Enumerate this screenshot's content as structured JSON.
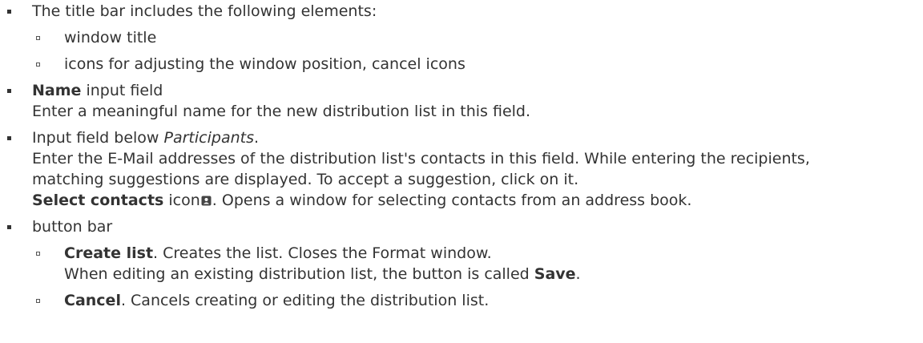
{
  "items": {
    "title_bar": {
      "text": "The title bar includes the following elements:",
      "sub": [
        "window title",
        "icons for adjusting the window position, cancel icons"
      ]
    },
    "name_field": {
      "bold": "Name",
      "rest": " input field",
      "line2": "Enter a meaningful name for the new distribution list in this field."
    },
    "participants": {
      "pre": "Input field below ",
      "italic": "Participants",
      "post": ".",
      "line2": "Enter the E-Mail addresses of the distribution list's contacts in this field. While entering the recipients,",
      "line3": "matching suggestions are displayed. To accept a suggestion, click on it.",
      "select_bold": "Select contacts",
      "select_mid": " icon",
      "select_rest": ". Opens a window for selecting contacts from an address book.",
      "select_icon": "address-book-icon"
    },
    "button_bar": {
      "text": "button bar",
      "create": {
        "bold": "Create list",
        "rest": ". Creates the list. Closes the Format window.",
        "line2_pre": "When editing an existing distribution list, the button is called ",
        "line2_bold": "Save",
        "line2_post": "."
      },
      "cancel": {
        "bold": "Cancel",
        "rest": ". Cancels creating or editing the distribution list."
      }
    }
  }
}
